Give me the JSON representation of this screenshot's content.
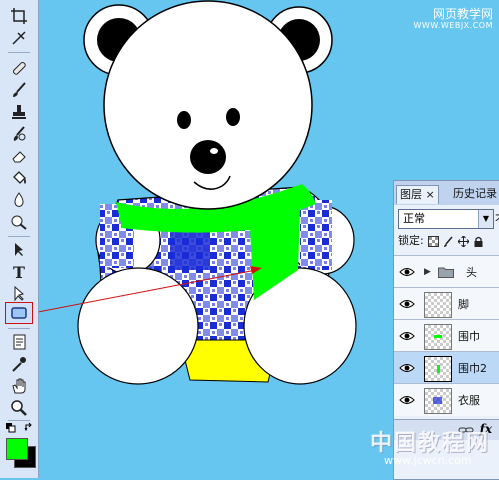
{
  "app": "Photoshop",
  "watermark_top": {
    "line1": "网页教学网",
    "line2": "WWW.WEBJX.COM"
  },
  "layers_panel": {
    "tabs": [
      {
        "label": "图层",
        "close": "×",
        "active": true
      },
      {
        "label": "历史记录",
        "active": false
      }
    ],
    "blend_mode": "正常",
    "opacity_label_partial": "不",
    "lock_label": "锁定:",
    "lock_icons": [
      "lock-transparent-icon",
      "lock-image-icon",
      "lock-position-icon",
      "lock-all-icon"
    ],
    "layers": [
      {
        "name": "头",
        "type": "group",
        "visible": true,
        "active": false
      },
      {
        "name": "脚",
        "type": "layer",
        "visible": true,
        "active": false
      },
      {
        "name": "围巾",
        "type": "layer",
        "visible": true,
        "active": false
      },
      {
        "name": "围巾2",
        "type": "layer",
        "visible": true,
        "active": true
      },
      {
        "name": "衣服",
        "type": "layer",
        "visible": true,
        "active": false
      }
    ],
    "fx_label": "fx"
  },
  "toolbar": {
    "tools": [
      "crop-tool",
      "slice-tool",
      "healing-brush-tool",
      "brush-tool",
      "clone-stamp-tool",
      "history-brush-tool",
      "eraser-tool",
      "paint-bucket-tool",
      "blur-tool",
      "dodge-tool",
      "path-selection-tool",
      "type-tool",
      "direct-selection-tool",
      "rectangle-shape-tool",
      "notes-tool",
      "eyedropper-tool",
      "hand-tool",
      "zoom-tool"
    ],
    "selected_tool": "rectangle-shape-tool",
    "type_tool_glyph": "T",
    "foreground_color": "#00ff00",
    "background_color": "#000000"
  },
  "colors": {
    "canvas_bg": "#66c6f0",
    "scarf": "#00ff00",
    "pants": "#ffff00",
    "shirt_blue": "#1a2cd6"
  },
  "watermark_bottom": {
    "line1": "中国教程网",
    "line2": "www.jcwcn.com"
  }
}
